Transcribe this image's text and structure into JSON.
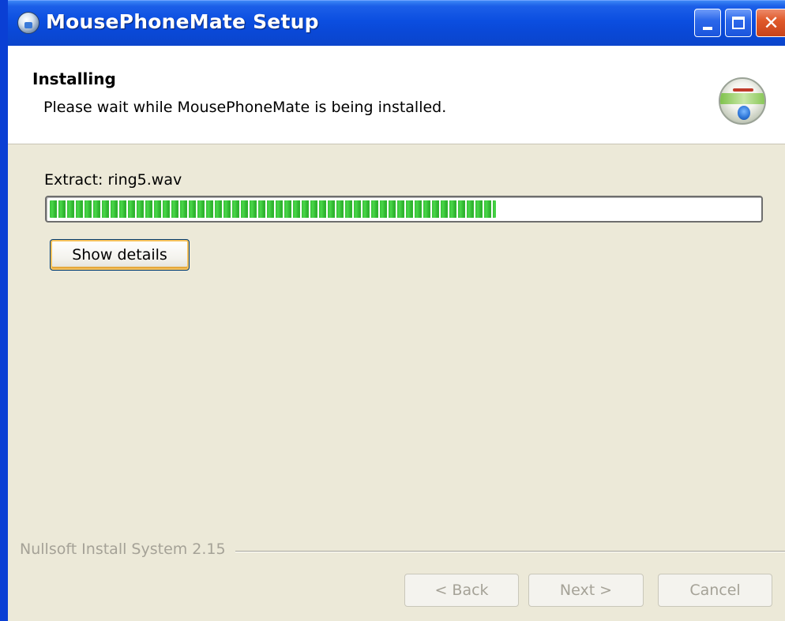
{
  "window": {
    "title": "MousePhoneMate Setup",
    "buttons": {
      "minimize": "minimize",
      "maximize": "maximize",
      "close": "close"
    }
  },
  "header": {
    "title": "Installing",
    "subtitle": "Please wait while MousePhoneMate is being installed.",
    "icon": "installer-disc-icon"
  },
  "progress": {
    "status_text": "Extract: ring5.wav",
    "percent": 63
  },
  "details_button": "Show details",
  "branding": "Nullsoft Install System 2.15",
  "footer": {
    "back": "< Back",
    "next": "Next >",
    "cancel": "Cancel",
    "back_enabled": false,
    "next_enabled": false,
    "cancel_enabled": false
  },
  "colors": {
    "titlebar": "#0a48d6",
    "progress_fill": "#38c038",
    "dialog_bg": "#ece9d8"
  }
}
